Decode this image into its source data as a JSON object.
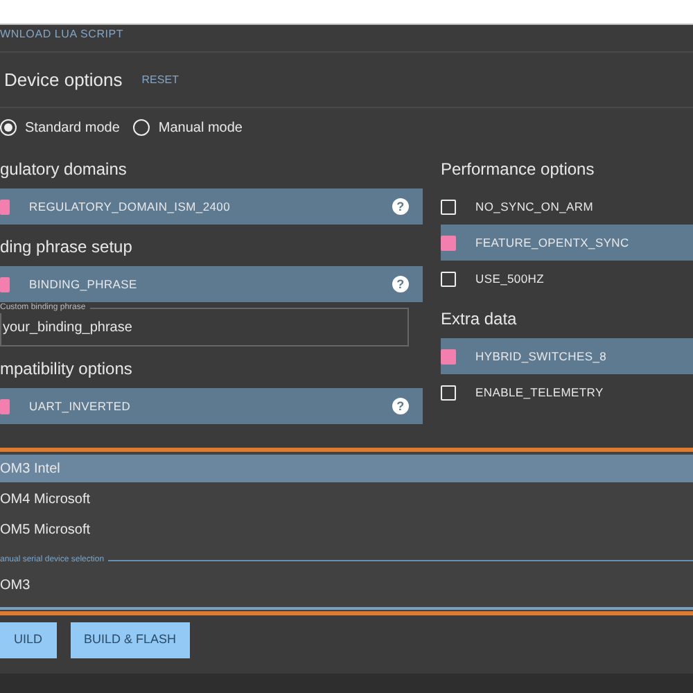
{
  "top_link": "WNLOAD LUA SCRIPT",
  "device_options": {
    "title": "Device options",
    "reset": "RESET"
  },
  "modes": [
    {
      "label": "Standard mode",
      "selected": true
    },
    {
      "label": "Manual mode",
      "selected": false
    }
  ],
  "left_sections": [
    {
      "title": "gulatory domains",
      "options": [
        {
          "label": "REGULATORY_DOMAIN_ISM_2400",
          "checked": true,
          "help": "?"
        }
      ]
    },
    {
      "title": "ding phrase setup",
      "options": [
        {
          "label": "BINDING_PHRASE",
          "checked": true,
          "help": "?"
        }
      ],
      "field": {
        "label": "Custom binding phrase",
        "value": "your_binding_phrase"
      }
    },
    {
      "title": "mpatibility options",
      "options": [
        {
          "label": "UART_INVERTED",
          "checked": true,
          "help": "?"
        }
      ]
    }
  ],
  "right_sections": [
    {
      "title": "Performance options",
      "options": [
        {
          "label": "NO_SYNC_ON_ARM",
          "checked": false
        },
        {
          "label": "FEATURE_OPENTX_SYNC",
          "checked": true
        },
        {
          "label": "USE_500HZ",
          "checked": false
        }
      ]
    },
    {
      "title": "Extra data",
      "options": [
        {
          "label": "HYBRID_SWITCHES_8",
          "checked": true
        },
        {
          "label": "ENABLE_TELEMETRY",
          "checked": false
        }
      ]
    }
  ],
  "device_menu": {
    "items": [
      {
        "label": "OM3 Intel",
        "selected": true
      },
      {
        "label": "OM4 Microsoft",
        "selected": false
      },
      {
        "label": "OM5 Microsoft",
        "selected": false
      }
    ],
    "field": {
      "label": "anual serial device selection",
      "value": "OM3"
    }
  },
  "buttons": [
    "UILD",
    "BUILD & FLASH"
  ]
}
